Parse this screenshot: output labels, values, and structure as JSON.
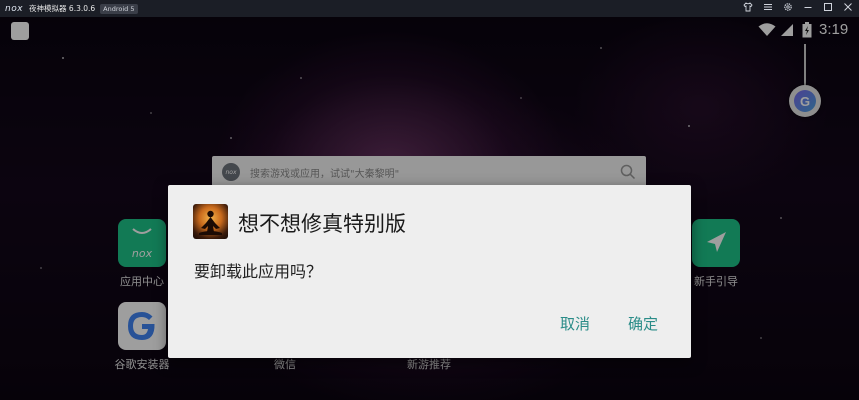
{
  "titlebar": {
    "logo": "nox",
    "title": "夜神模拟器 6.3.0.6",
    "badge": "Android 5",
    "icons": [
      "tshirt-icon",
      "menu-icon",
      "settings-icon",
      "minimize-icon",
      "maximize-icon",
      "close-icon"
    ]
  },
  "statusbar": {
    "time": "3:19"
  },
  "search": {
    "logo": "nox",
    "placeholder": "搜索游戏或应用，试试\"大秦黎明\""
  },
  "apps": [
    {
      "label": "应用中心",
      "icon": "nox-app-center-icon",
      "color": "#1ec68a"
    },
    {
      "label": "谷歌安装器",
      "icon": "google-installer-icon",
      "color": "#ffffff"
    },
    {
      "label": "新手引导",
      "icon": "navigation-arrow-icon",
      "color": "#1ec68a"
    },
    {
      "label": "微信",
      "icon": "wechat-icon",
      "color": "#1ec68a"
    },
    {
      "label": "新游推荐",
      "icon": "new-games-icon",
      "color": "#1ec68a"
    }
  ],
  "dialog": {
    "app_name": "想不想修真特别版",
    "message": "要卸载此应用吗？",
    "cancel_label": "取消",
    "ok_label": "确定",
    "accent_color": "#2a8c88"
  }
}
